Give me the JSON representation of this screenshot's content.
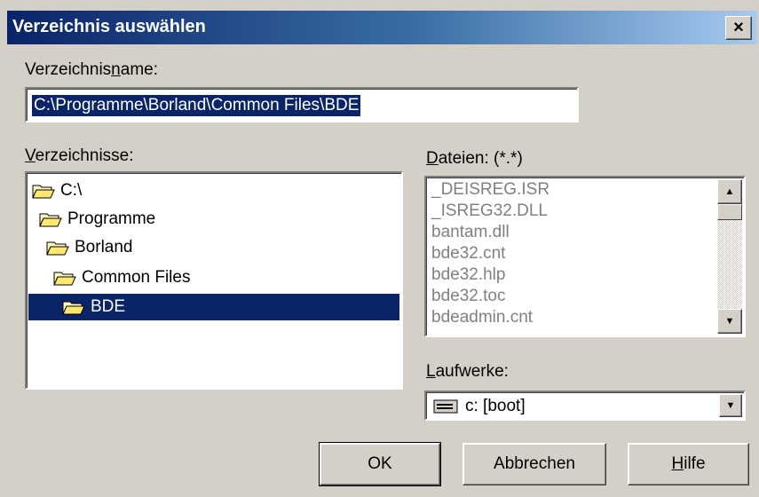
{
  "window": {
    "title": "Verzeichnis auswählen",
    "close_glyph": "×"
  },
  "dirname": {
    "label_pre": "Verzeichnis",
    "label_accel": "n",
    "label_post": "ame:",
    "value": "C:\\Programme\\Borland\\Common Files\\BDE"
  },
  "directories": {
    "label_accel": "V",
    "label_post": "erzeichnisse:",
    "items": [
      {
        "label": "C:\\",
        "icon": "open-folder-icon"
      },
      {
        "label": "Programme",
        "icon": "open-folder-icon"
      },
      {
        "label": "Borland",
        "icon": "open-folder-icon"
      },
      {
        "label": "Common Files",
        "icon": "open-folder-icon"
      },
      {
        "label": "BDE",
        "icon": "open-folder-icon",
        "selected": true
      }
    ]
  },
  "files": {
    "label_accel": "D",
    "label_post": "ateien: (*.*)",
    "items": [
      "_DEISREG.ISR",
      "_ISREG32.DLL",
      "bantam.dll",
      "bde32.cnt",
      "bde32.hlp",
      "bde32.toc",
      "bdeadmin.cnt"
    ]
  },
  "drives": {
    "label_accel": "L",
    "label_post": "aufwerke:",
    "value": "c: [boot]",
    "icon": "drive-icon"
  },
  "buttons": {
    "ok": "OK",
    "cancel": "Abbrechen",
    "help_accel": "H",
    "help_post": "ilfe"
  },
  "colors": {
    "selection": "#0a246a",
    "dialog_bg": "#d4d0c8"
  }
}
